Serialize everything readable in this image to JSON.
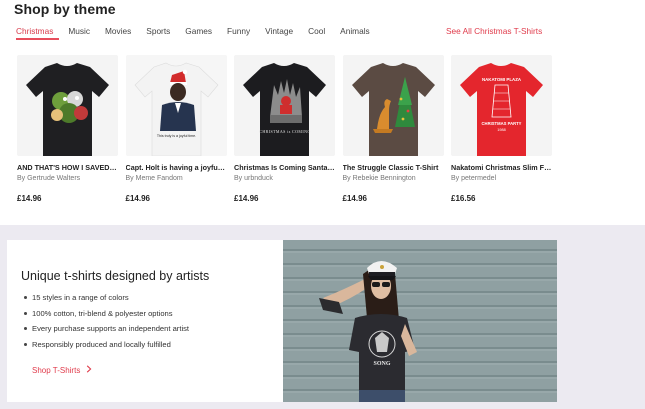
{
  "section": {
    "heading": "Shop by theme"
  },
  "tabs": [
    {
      "label": "Christmas",
      "active": true
    },
    {
      "label": "Music"
    },
    {
      "label": "Movies"
    },
    {
      "label": "Sports"
    },
    {
      "label": "Games"
    },
    {
      "label": "Funny"
    },
    {
      "label": "Vintage"
    },
    {
      "label": "Cool"
    },
    {
      "label": "Animals"
    }
  ],
  "see_all": "See All Christmas T-Shirts",
  "products": [
    {
      "title": "AND THAT'S HOW I SAVED T...",
      "author": "By Gertrude Walters",
      "price": "£14.96",
      "shirt_color": "#1f1f22"
    },
    {
      "title": "Capt. Holt is having a joyful ...",
      "author": "By Meme Fandom",
      "price": "£14.96",
      "shirt_color": "#f3f3f3",
      "shirt_text": "This truly is a joyful time."
    },
    {
      "title": "Christmas Is Coming Santa C...",
      "author": "By urbnduck",
      "price": "£14.96",
      "shirt_color": "#1c1c1f",
      "shirt_text": "CHRISTMAS is COMING"
    },
    {
      "title": "The Struggle Classic T-Shirt",
      "author": "By Rebekie Bennington",
      "price": "£14.96",
      "shirt_color": "#5b4b43"
    },
    {
      "title": "Nakatomi Christmas Slim Fit...",
      "author": "By petermedel",
      "price": "£16.56",
      "shirt_color": "#e4262d",
      "shirt_text_top": "NAKATOMI PLAZA",
      "shirt_text_bottom": "CHRISTMAS PARTY",
      "shirt_text_year": "1988"
    }
  ],
  "banner": {
    "title": "Unique t-shirts designed by artists",
    "features": [
      "15 styles in a range of colors",
      "100% cotton, tri-blend & polyester options",
      "Every purchase supports an independent artist",
      "Responsibly produced and locally fulfilled"
    ],
    "link": "Shop T-Shirts",
    "tee_text": "SONG"
  }
}
